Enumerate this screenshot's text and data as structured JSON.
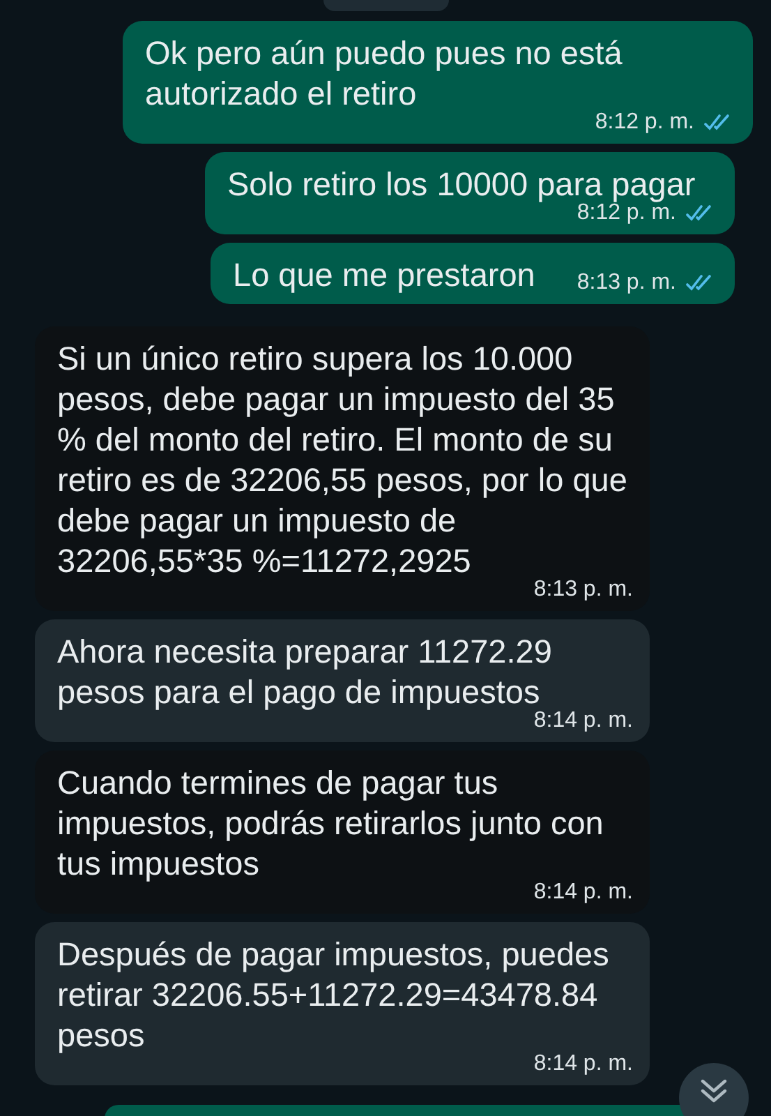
{
  "messages": [
    {
      "kind": "outgoing",
      "text": "Ok pero aún puedo pues no está autorizado el retiro",
      "time": "8:12 p. m.",
      "read": true
    },
    {
      "kind": "outgoing",
      "text": "Solo retiro los 10000 para pagar",
      "time": "8:12 p. m.",
      "read": true
    },
    {
      "kind": "outgoing",
      "text": "Lo que me prestaron",
      "time": "8:13 p. m.",
      "read": true
    },
    {
      "kind": "incoming",
      "text": "Si un único retiro supera los 10.000 pesos, debe pagar un impuesto del 35 % del monto del retiro. El monto de su retiro es de 32206,55 pesos, por lo que debe pagar un impuesto de 32206,55*35 %=11272,2925",
      "time": "8:13 p. m.",
      "color": "#0d1114"
    },
    {
      "kind": "incoming",
      "text": "Ahora necesita preparar 11272.29 pesos para el pago de impuestos",
      "time": "8:14 p. m.",
      "color": "#1f2a30"
    },
    {
      "kind": "incoming",
      "text": "Cuando termines de pagar tus impuestos, podrás retirarlos junto con tus impuestos",
      "time": "8:14 p. m.",
      "color": "#0d1114"
    },
    {
      "kind": "incoming",
      "text": "Después de pagar impuestos, puedes retirar 32206.55+11272.29=43478.84 pesos",
      "time": "8:14 p. m.",
      "color": "#1f2a30"
    }
  ]
}
